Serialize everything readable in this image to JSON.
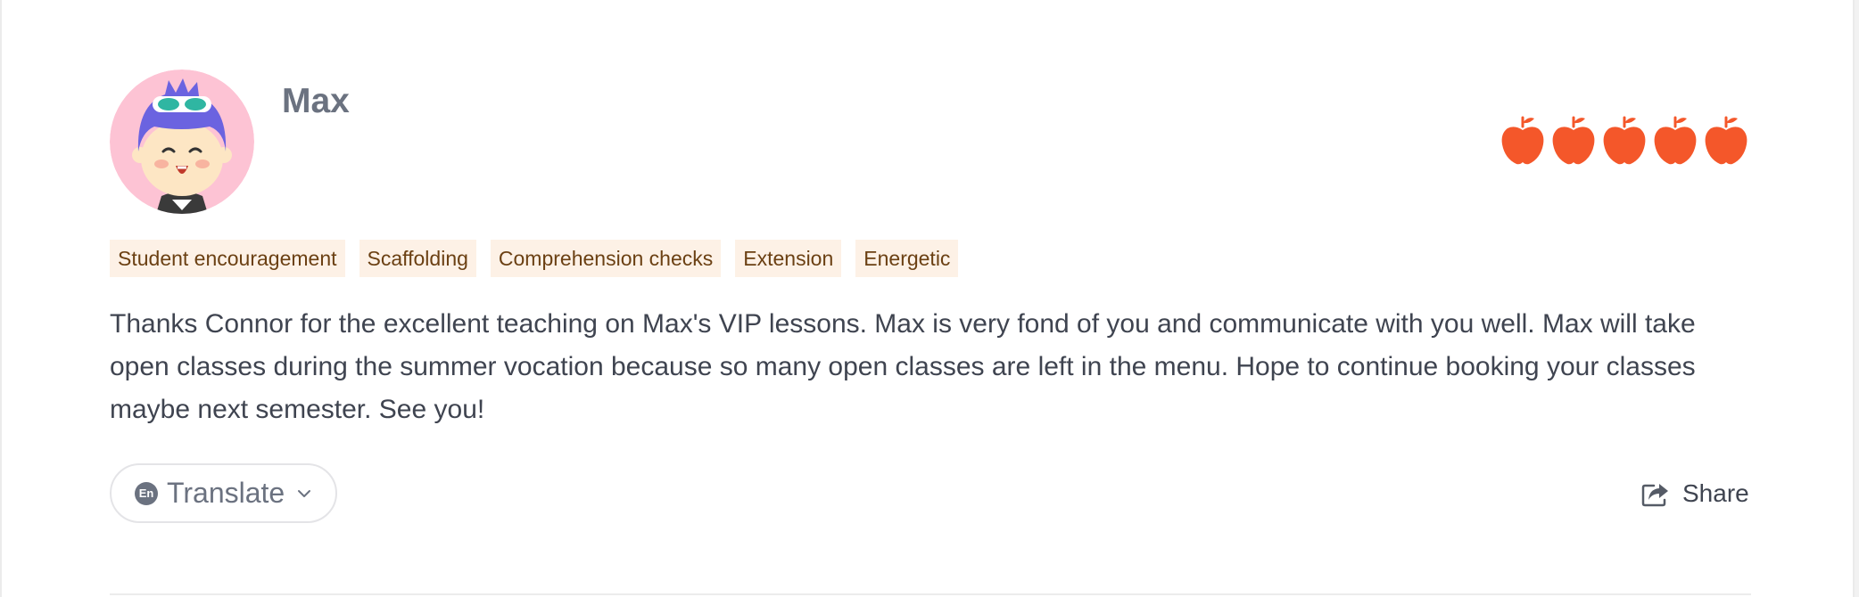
{
  "review": {
    "author_name": "Max",
    "rating": 5,
    "rating_max": 5,
    "rating_icon": "apple-icon",
    "rating_color": "#f4572a",
    "tags": [
      "Student encouragement",
      "Scaffolding",
      "Comprehension checks",
      "Extension",
      "Energetic"
    ],
    "comment": "Thanks Connor for the excellent teaching on Max's VIP lessons. Max is very fond of you and communicate with you well. Max will take open classes during the summer vocation because so many open classes are left in the menu. Hope to continue booking your classes maybe next semester. See you!"
  },
  "actions": {
    "translate_badge": "En",
    "translate_label": "Translate",
    "share_label": "Share"
  },
  "colors": {
    "tag_bg": "#fdf1e6",
    "tag_text": "#6b4013",
    "avatar_bg": "#fdc3d4"
  }
}
